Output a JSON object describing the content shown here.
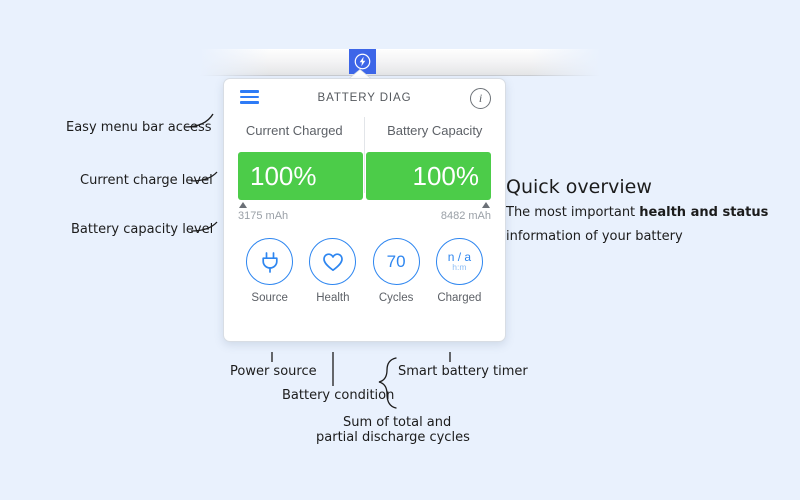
{
  "background_color": "#e9f1fd",
  "menubar": {
    "icon_name": "lightning-bolt-icon",
    "tile_color": "#3d66e8"
  },
  "popover": {
    "title": "BATTERY DIAG",
    "menu_icon": "hamburger-menu-icon",
    "info_icon": "info-circle-icon",
    "info_glyph": "i",
    "bar_color": "#4ccc49",
    "accent_color": "#2e86f0",
    "sections": [
      {
        "label": "Current Charged",
        "percent": "100%",
        "capacity": "3175 mAh"
      },
      {
        "label": "Battery Capacity",
        "percent": "100%",
        "capacity": "8482 mAh"
      }
    ],
    "stats": [
      {
        "icon": "power-plug-icon",
        "value": "",
        "sub": "",
        "label": "Source"
      },
      {
        "icon": "heart-icon",
        "value": "",
        "sub": "",
        "label": "Health"
      },
      {
        "icon": "cycles-count-icon",
        "value": "70",
        "sub": "",
        "label": "Cycles"
      },
      {
        "icon": "time-remaining-icon",
        "value": "n / a",
        "sub": "h:m",
        "label": "Charged"
      }
    ]
  },
  "annotations": {
    "left": [
      "Easy menu bar access",
      "Current charge level",
      "Battery capacity level"
    ],
    "bottom": [
      "Power source",
      "Battery condition",
      "Smart battery timer",
      "Sum of total and",
      "partial discharge cycles"
    ]
  },
  "quick_overview": {
    "title": "Quick overview",
    "line1_pre": "The most important ",
    "line1_bold": "health and status",
    "line2": "information of your battery"
  }
}
